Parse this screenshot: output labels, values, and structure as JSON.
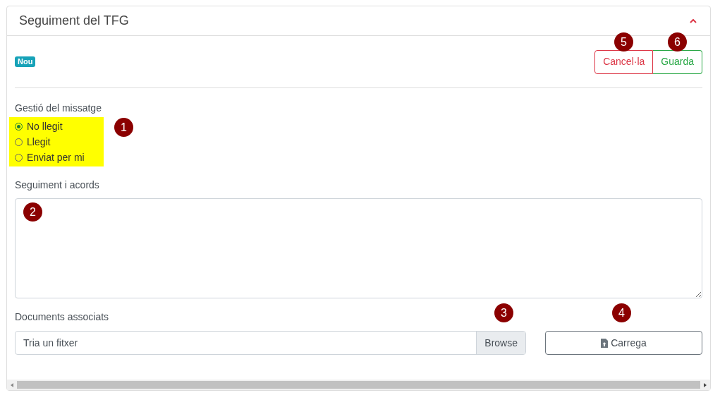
{
  "panel": {
    "title": "Seguiment del TFG",
    "expanded": true
  },
  "badge": "Nou",
  "actions": [
    {
      "label": "Cancel·la",
      "kind": "cancel"
    },
    {
      "label": "Guarda",
      "kind": "save"
    }
  ],
  "message_status": {
    "label": "Gestió del missatge",
    "options": [
      {
        "label": "No llegit",
        "selected": true
      },
      {
        "label": "Llegit",
        "selected": false
      },
      {
        "label": "Enviat per mi",
        "selected": false
      }
    ]
  },
  "notes": {
    "label": "Seguiment i acords"
  },
  "documents": {
    "label": "Documents associats",
    "placeholder": "Tria un fitxer",
    "browse": "Browse",
    "upload": "Carrega"
  },
  "annotations": [
    "1",
    "2",
    "3",
    "4",
    "5",
    "6"
  ]
}
